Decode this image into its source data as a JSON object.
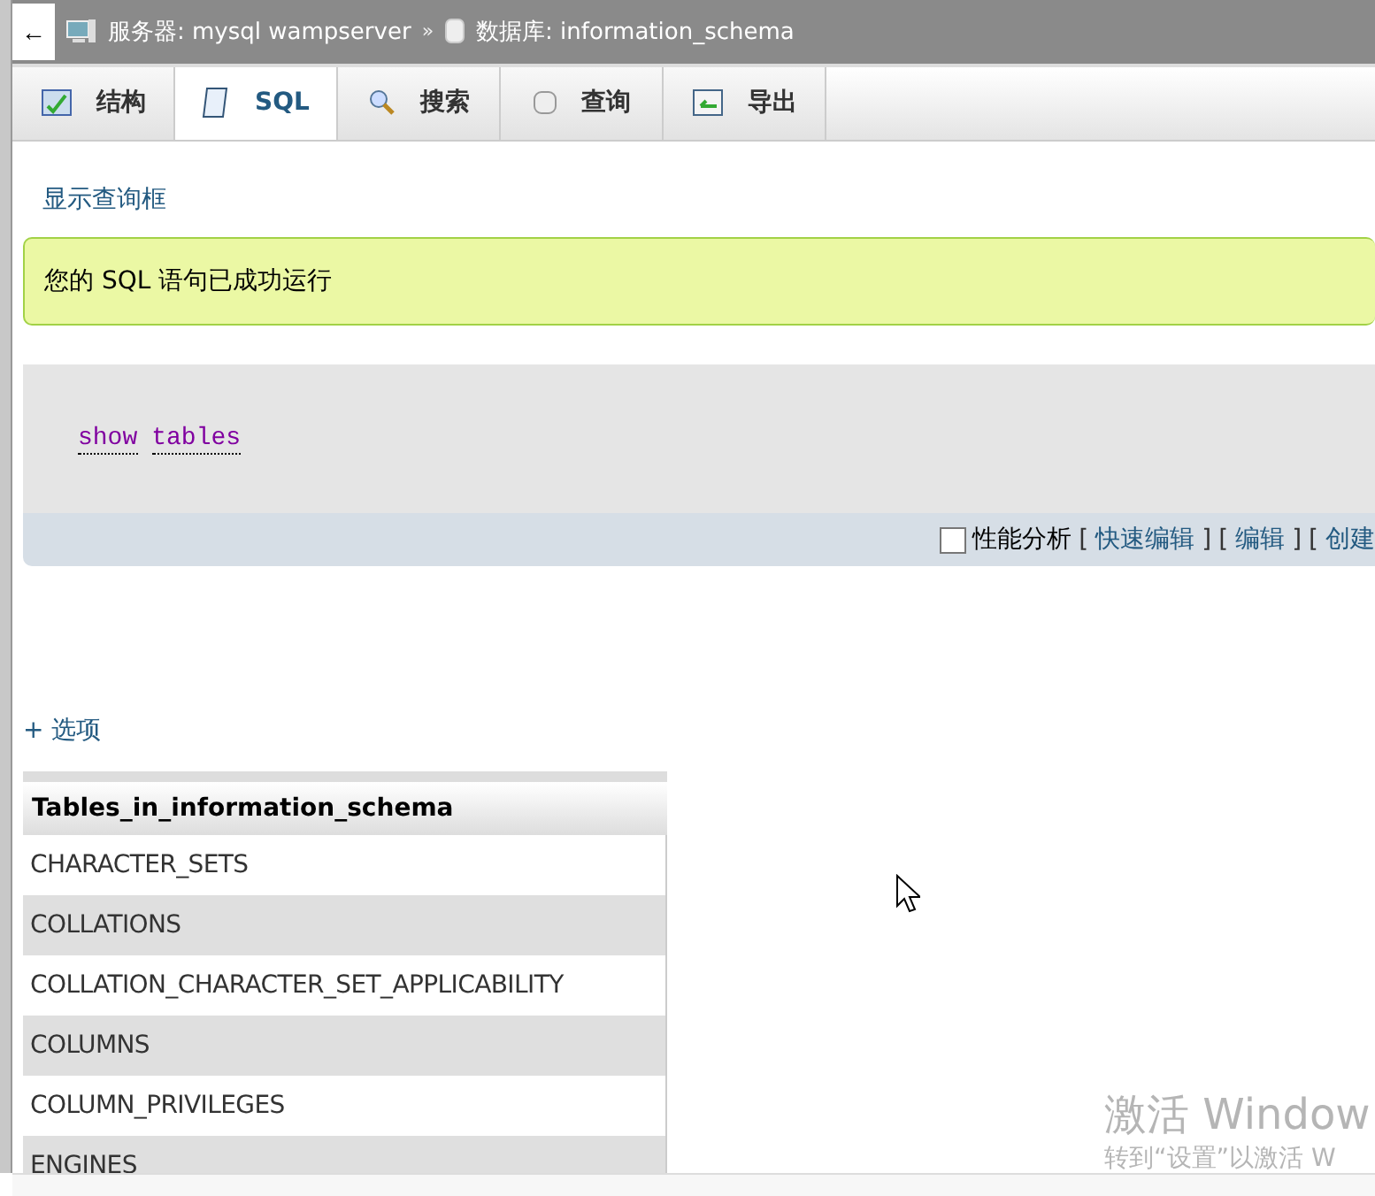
{
  "breadcrumb": {
    "back": "←",
    "items": [
      {
        "kind": "server",
        "label": "服务器: mysql wampserver"
      },
      {
        "kind": "database",
        "label": "数据库: information_schema"
      }
    ],
    "separator": "»"
  },
  "tabs": [
    {
      "kind": "structure",
      "label": "结构",
      "selected": false
    },
    {
      "kind": "sql",
      "label": "SQL",
      "selected": true
    },
    {
      "kind": "search",
      "label": "搜索",
      "selected": false
    },
    {
      "kind": "query",
      "label": "查询",
      "selected": false
    },
    {
      "kind": "export",
      "label": "导出",
      "selected": false
    }
  ],
  "show_query_link": "显示查询框",
  "success_message": "您的 SQL 语句已成功运行",
  "sql_words": [
    "show",
    "tables"
  ],
  "sql_actions": {
    "profiling": {
      "label": "性能分析",
      "checked": false
    },
    "items": [
      {
        "kind": "bracket",
        "text": "["
      },
      {
        "kind": "link",
        "text": "快速编辑"
      },
      {
        "kind": "bracket",
        "text": "]"
      },
      {
        "kind": "bracket",
        "text": "["
      },
      {
        "kind": "link",
        "text": "编辑"
      },
      {
        "kind": "bracket",
        "text": "]"
      },
      {
        "kind": "bracket",
        "text": "["
      },
      {
        "kind": "link",
        "text": "创建"
      }
    ]
  },
  "options_link": "+ 选项",
  "table": {
    "columns": [
      "Tables_in_information_schema"
    ],
    "rows": [
      "CHARACTER_SETS",
      "COLLATIONS",
      "COLLATION_CHARACTER_SET_APPLICABILITY",
      "COLUMNS",
      "COLUMN_PRIVILEGES",
      "ENGINES"
    ]
  },
  "activation_notice": {
    "title": "激活 Window",
    "hint": "转到“设置”以激活 W"
  }
}
